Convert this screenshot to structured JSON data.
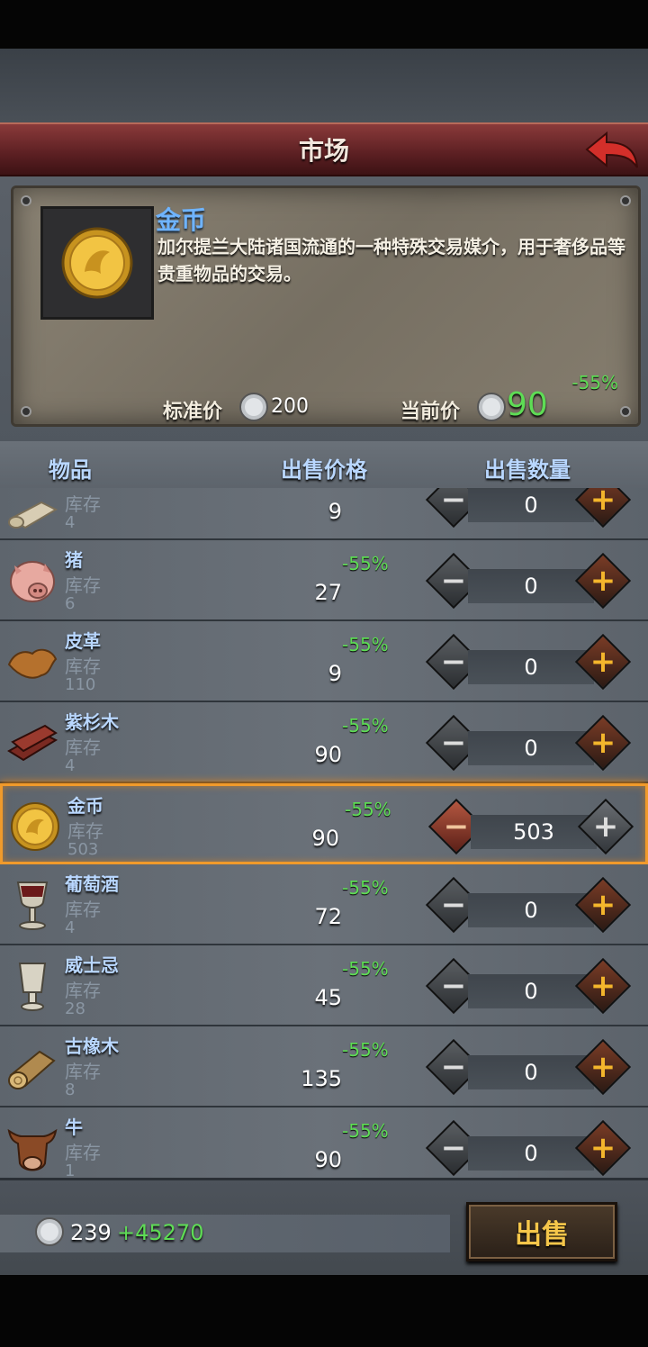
{
  "header": {
    "title": "市场"
  },
  "detail": {
    "name": "金币",
    "description": "加尔提兰大陆诸国流通的一种特殊交易媒介，用于奢侈品等贵重物品的交易。",
    "discount": "-55%",
    "standard_price_label": "标准价",
    "standard_price": "200",
    "current_price_label": "当前价",
    "current_price": "90"
  },
  "columns": {
    "item": "物品",
    "price": "出售价格",
    "quantity": "出售数量"
  },
  "items": [
    {
      "name": "",
      "stock_label": "库存",
      "stock": "4",
      "discount": "",
      "price": "9",
      "qty": "0",
      "icon": "paper-scroll-icon"
    },
    {
      "name": "猪",
      "stock_label": "库存",
      "stock": "6",
      "discount": "-55%",
      "price": "27",
      "qty": "0",
      "icon": "pig-icon"
    },
    {
      "name": "皮革",
      "stock_label": "库存",
      "stock": "110",
      "discount": "-55%",
      "price": "9",
      "qty": "0",
      "icon": "leather-icon"
    },
    {
      "name": "紫杉木",
      "stock_label": "库存",
      "stock": "4",
      "discount": "-55%",
      "price": "90",
      "qty": "0",
      "icon": "yew-wood-icon"
    },
    {
      "name": "金币",
      "stock_label": "库存",
      "stock": "503",
      "discount": "-55%",
      "price": "90",
      "qty": "503",
      "icon": "gold-coin-icon",
      "selected": true
    },
    {
      "name": "葡萄酒",
      "stock_label": "库存",
      "stock": "4",
      "discount": "-55%",
      "price": "72",
      "qty": "0",
      "icon": "wine-goblet-icon"
    },
    {
      "name": "威士忌",
      "stock_label": "库存",
      "stock": "28",
      "discount": "-55%",
      "price": "45",
      "qty": "0",
      "icon": "whiskey-cup-icon"
    },
    {
      "name": "古橡木",
      "stock_label": "库存",
      "stock": "8",
      "discount": "-55%",
      "price": "135",
      "qty": "0",
      "icon": "oak-log-icon"
    },
    {
      "name": "牛",
      "stock_label": "库存",
      "stock": "1",
      "discount": "-55%",
      "price": "90",
      "qty": "0",
      "icon": "cow-icon"
    }
  ],
  "footer": {
    "silver": "239",
    "gain": "+45270",
    "sell_label": "出售"
  },
  "colors": {
    "accent_green": "#5edc55",
    "name_blue": "#6fb4ff",
    "selection_orange": "#f09a2b",
    "sell_gold": "#f5c64a"
  }
}
